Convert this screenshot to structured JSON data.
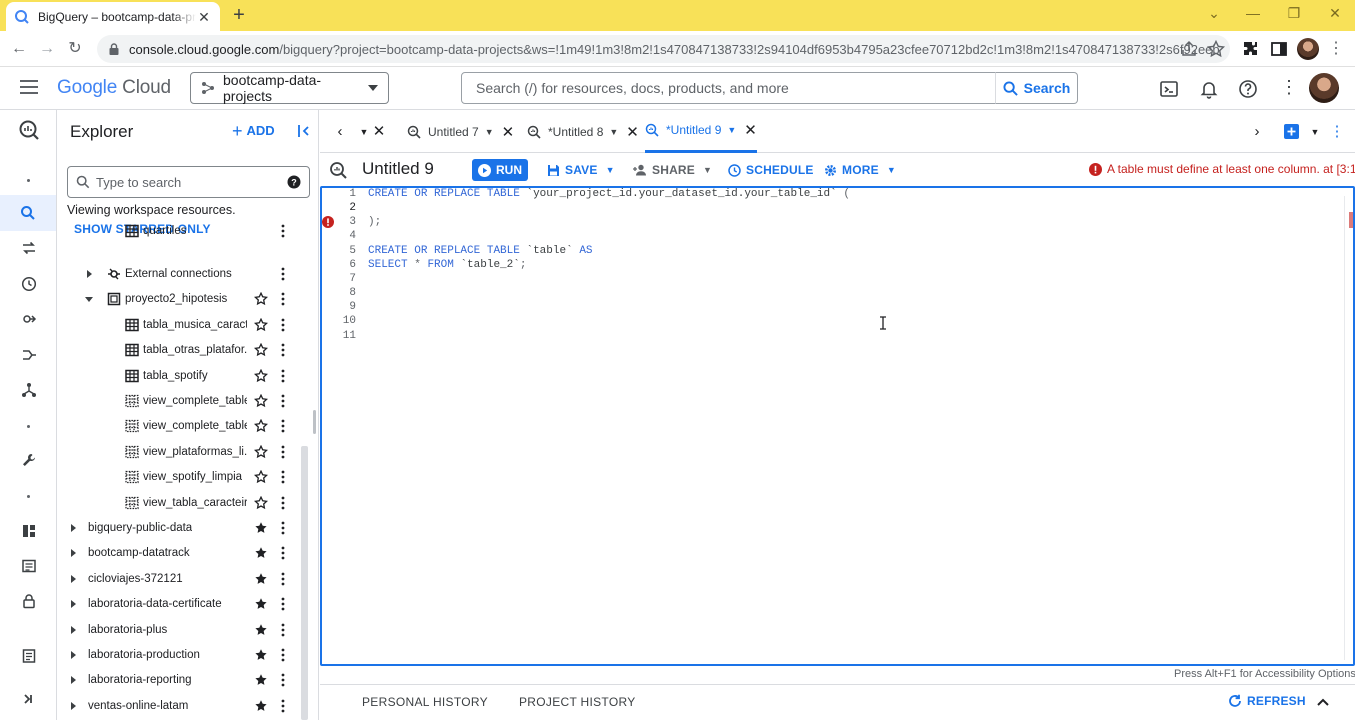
{
  "browser": {
    "tab_title": "BigQuery – bootcamp-data-projects",
    "url_host": "console.cloud.google.com",
    "url_path": "/bigquery?project=bootcamp-data-projects&ws=!1m49!1m3!8m2!1s470847138733!2s94104df6953b4795a23cfee70712bd2c!1m3!8m2!1s470847138733!2s6f92eebf..."
  },
  "header": {
    "logo_google": "Google",
    "logo_cloud": "Cloud",
    "project": "bootcamp-data-projects",
    "search_placeholder": "Search (/) for resources, docs, products, and more",
    "search_button": "Search"
  },
  "explorer": {
    "title": "Explorer",
    "add_label": "ADD",
    "search_placeholder": "Type to search",
    "viewing": "Viewing workspace resources.",
    "starred_only": "SHOW STARRED ONLY",
    "rows": [
      {
        "label": "quartiles",
        "kind": "table",
        "indent": 2,
        "star": false
      },
      {
        "label": "External connections",
        "kind": "connection",
        "indent": 1,
        "caret": "right",
        "star": false
      },
      {
        "label": "proyecto2_hipotesis",
        "kind": "dataset",
        "indent": 1,
        "caret": "down",
        "star": true
      },
      {
        "label": "tabla_musica_caract...",
        "kind": "table",
        "indent": 2,
        "star": true
      },
      {
        "label": "tabla_otras_platafor...",
        "kind": "table",
        "indent": 2,
        "star": true
      },
      {
        "label": "tabla_spotify",
        "kind": "table",
        "indent": 2,
        "star": true
      },
      {
        "label": "view_complete_table",
        "kind": "view",
        "indent": 2,
        "star": true
      },
      {
        "label": "view_complete_table...",
        "kind": "view",
        "indent": 2,
        "star": true
      },
      {
        "label": "view_plataformas_li...",
        "kind": "view",
        "indent": 2,
        "star": true
      },
      {
        "label": "view_spotify_limpia",
        "kind": "view",
        "indent": 2,
        "star": true
      },
      {
        "label": "view_tabla_caracteir...",
        "kind": "view",
        "indent": 2,
        "star": true
      },
      {
        "label": "bigquery-public-data",
        "kind": "project",
        "indent": 0,
        "caret": "right",
        "star": "filled"
      },
      {
        "label": "bootcamp-datatrack",
        "kind": "project",
        "indent": 0,
        "caret": "right",
        "star": "filled"
      },
      {
        "label": "cicloviajes-372121",
        "kind": "project",
        "indent": 0,
        "caret": "right",
        "star": "filled"
      },
      {
        "label": "laboratoria-data-certificate",
        "kind": "project",
        "indent": 0,
        "caret": "right",
        "star": "filled"
      },
      {
        "label": "laboratoria-plus",
        "kind": "project",
        "indent": 0,
        "caret": "right",
        "star": "filled"
      },
      {
        "label": "laboratoria-production",
        "kind": "project",
        "indent": 0,
        "caret": "right",
        "star": "filled"
      },
      {
        "label": "laboratoria-reporting",
        "kind": "project",
        "indent": 0,
        "caret": "right",
        "star": "filled"
      },
      {
        "label": "ventas-online-latam",
        "kind": "project",
        "indent": 0,
        "caret": "right",
        "star": "filled"
      }
    ]
  },
  "editor_tabs": [
    {
      "label": "Untitled 7",
      "active": false
    },
    {
      "label": "*Untitled 8",
      "active": false
    },
    {
      "label": "*Untitled 9",
      "active": true
    }
  ],
  "query": {
    "title": "Untitled 9",
    "run": "RUN",
    "save": "SAVE",
    "share": "SHARE",
    "schedule": "SCHEDULE",
    "more": "MORE",
    "error": "A table must define at least one column. at [3:1]"
  },
  "code_lines": [
    "CREATE OR REPLACE TABLE `your_project_id.your_dataset_id.your_table_id` (",
    "",
    ");",
    "",
    "CREATE OR REPLACE TABLE `table` AS",
    "SELECT * FROM `table_2`;",
    "",
    "",
    "",
    "",
    ""
  ],
  "line_numbers": [
    "1",
    "2",
    "3",
    "4",
    "5",
    "6",
    "7",
    "8",
    "9",
    "10",
    "11"
  ],
  "accessibility_hint": "Press Alt+F1 for Accessibility Options.",
  "bottom": {
    "personal_history": "PERSONAL HISTORY",
    "project_history": "PROJECT HISTORY",
    "refresh": "REFRESH"
  },
  "colors": {
    "accent": "#1a73e8",
    "error": "#c5221f",
    "chrome_tabstrip": "#f8e158"
  }
}
